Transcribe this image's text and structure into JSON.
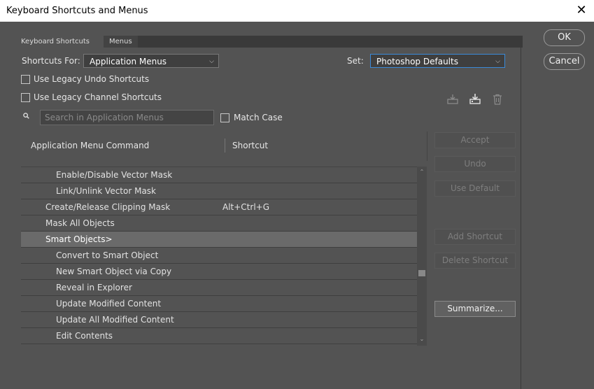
{
  "window": {
    "title": "Keyboard Shortcuts and Menus",
    "close_glyph": "✕"
  },
  "tabs": [
    {
      "label": "Keyboard Shortcuts"
    },
    {
      "label": "Menus"
    }
  ],
  "shortcuts_for": {
    "label": "Shortcuts For:",
    "value": "Application Menus"
  },
  "set": {
    "label": "Set:",
    "value": "Photoshop Defaults"
  },
  "options": {
    "legacy_undo": "Use Legacy Undo Shortcuts",
    "legacy_channel": "Use Legacy Channel Shortcuts",
    "match_case": "Match Case"
  },
  "search": {
    "placeholder": "Search in Application Menus"
  },
  "table": {
    "col_command": "Application Menu Command",
    "col_shortcut": "Shortcut",
    "rows": [
      {
        "command": "Enable/Disable Vector Mask",
        "shortcut": "",
        "indent": 2
      },
      {
        "command": "Link/Unlink Vector Mask",
        "shortcut": "",
        "indent": 2
      },
      {
        "command": "Create/Release Clipping Mask",
        "shortcut": "Alt+Ctrl+G",
        "indent": 1
      },
      {
        "command": "Mask All Objects",
        "shortcut": "",
        "indent": 1
      },
      {
        "command": "Smart Objects>",
        "shortcut": "",
        "indent": 1,
        "selected": true
      },
      {
        "command": "Convert to Smart Object",
        "shortcut": "",
        "indent": 2
      },
      {
        "command": "New Smart Object via Copy",
        "shortcut": "",
        "indent": 2
      },
      {
        "command": "Reveal in Explorer",
        "shortcut": "",
        "indent": 2
      },
      {
        "command": "Update Modified Content",
        "shortcut": "",
        "indent": 2
      },
      {
        "command": "Update All Modified Content",
        "shortcut": "",
        "indent": 2
      },
      {
        "command": "Edit Contents",
        "shortcut": "",
        "indent": 2
      }
    ]
  },
  "buttons": {
    "accept": "Accept",
    "undo": "Undo",
    "use_default": "Use Default",
    "add_shortcut": "Add Shortcut",
    "delete_shortcut": "Delete Shortcut",
    "summarize": "Summarize...",
    "ok": "OK",
    "cancel": "Cancel"
  },
  "icons": {
    "save": "save-set-icon",
    "save_as": "new-set-icon",
    "delete": "trash-icon"
  }
}
